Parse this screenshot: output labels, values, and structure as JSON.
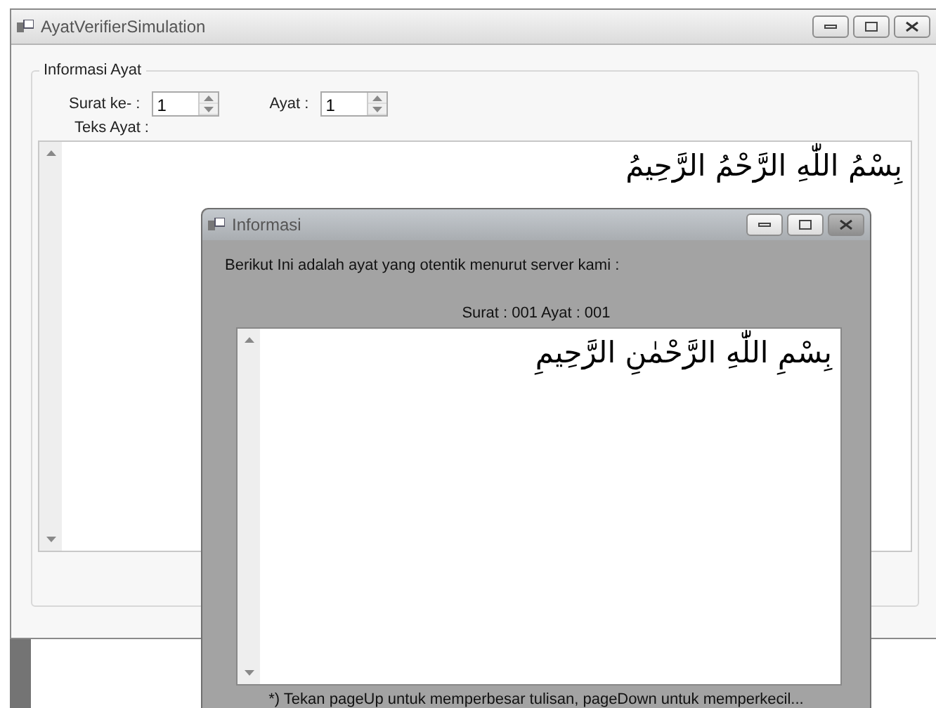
{
  "window": {
    "title": "AyatVerifierSimulation"
  },
  "group": {
    "title": "Informasi Ayat",
    "spinners": [
      {
        "label": "Surat ke- :",
        "value": "1"
      },
      {
        "label": "Ayat :",
        "value": "1"
      }
    ],
    "text_label": "Teks Ayat :",
    "verse_text": "بِسْمُ اللّٰهِ الرَّحْمُ الرَّحِيمُ"
  },
  "dialog": {
    "title": "Informasi",
    "message": "Berikut Ini adalah ayat yang otentik menurut server kami :",
    "reference": "Surat : 001 Ayat : 001",
    "verse_text": "بِسْمِ اللّٰهِ الرَّحْمٰنِ الرَّحِيمِ",
    "footnote": "*) Tekan pageUp untuk memperbesar tulisan, pageDown untuk memperkecil..."
  }
}
